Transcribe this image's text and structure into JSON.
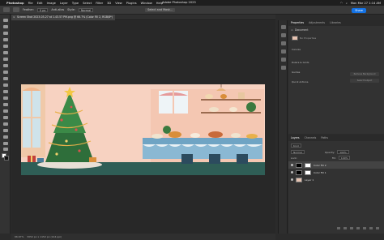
{
  "menubar": {
    "apple": "",
    "items": [
      "Photoshop",
      "File",
      "Edit",
      "Image",
      "Layer",
      "Type",
      "Select",
      "Filter",
      "3D",
      "View",
      "Plugins",
      "Window",
      "Help"
    ],
    "datetime": "Mon Mar 27  1:14 AM"
  },
  "options": {
    "app_title": "Adobe Photoshop 2023",
    "feather_label": "Feather:",
    "feather_value": "0 px",
    "antialias": "Anti-alias",
    "style_label": "Style:",
    "style_value": "Normal",
    "select_mask": "Select and Mask...",
    "share": "Share"
  },
  "document": {
    "tab_title": "Screen Shot 2023-03-27 at 1.43.57 PM.png @ 66.7% (Color Fill 2, RGB/8*)",
    "zoom": "66.67%",
    "dimensions": "3052 px x 1152 px (144 ppi)"
  },
  "properties_panel": {
    "tabs": [
      "Properties",
      "Adjustments",
      "Libraries"
    ],
    "doc_label": "Document",
    "no_props": "No Properties",
    "sections": [
      "Canvas",
      "Rulers & Grids",
      "Guides",
      "Quick Actions"
    ],
    "quick_buttons": [
      "Remove Background",
      "Select Subject"
    ]
  },
  "layers_panel": {
    "tabs": [
      "Layers",
      "Channels",
      "Paths"
    ],
    "kind": "Kind",
    "blend": "Normal",
    "opacity_label": "Opacity:",
    "opacity": "100%",
    "lock_label": "Lock:",
    "fill_label": "Fill:",
    "fill": "100%",
    "layers": [
      {
        "name": "Color Fill 2",
        "selected": true,
        "color": "#000000"
      },
      {
        "name": "Color Fill 1",
        "selected": false,
        "color": "#000000"
      },
      {
        "name": "Layer 1",
        "selected": false,
        "color": "#e5c2b0"
      }
    ]
  },
  "colors": {
    "accent": "#1473e6",
    "wall": "#f7d2c1",
    "floor": "#2f5e56",
    "tablecloth": "#6fa4c4",
    "tree": "#2e6e3a"
  }
}
